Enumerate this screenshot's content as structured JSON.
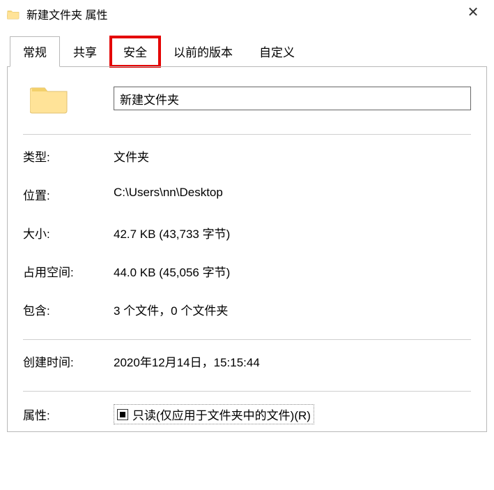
{
  "title": "新建文件夹 属性",
  "tabs": {
    "general": "常规",
    "share": "共享",
    "security": "安全",
    "previous": "以前的版本",
    "custom": "自定义"
  },
  "name_value": "新建文件夹",
  "labels": {
    "type": "类型:",
    "location": "位置:",
    "size": "大小:",
    "size_on_disk": "占用空间:",
    "contains": "包含:",
    "created": "创建时间:",
    "attributes": "属性:"
  },
  "values": {
    "type": "文件夹",
    "location": "C:\\Users\\nn\\Desktop",
    "size": "42.7 KB (43,733 字节)",
    "size_on_disk": "44.0 KB (45,056 字节)",
    "contains": "3 个文件，0 个文件夹",
    "created": "2020年12月14日，15:15:44"
  },
  "readonly_label": "只读(仅应用于文件夹中的文件)(R)"
}
